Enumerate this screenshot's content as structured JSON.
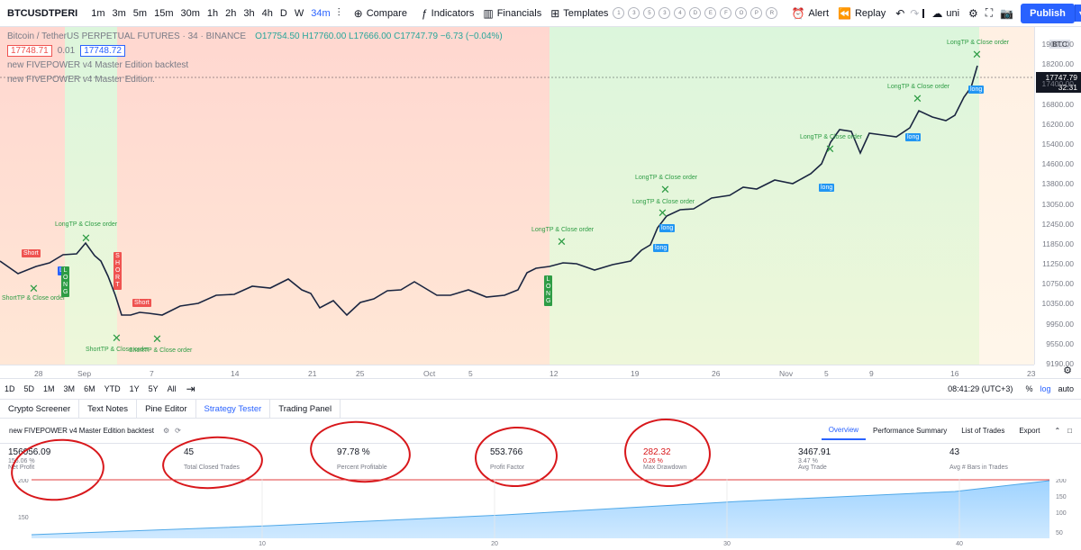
{
  "toolbar": {
    "symbol": "BTCUSDTPERI",
    "intervals": [
      "1m",
      "3m",
      "5m",
      "15m",
      "30m",
      "1h",
      "2h",
      "3h",
      "4h",
      "D",
      "W",
      "34m"
    ],
    "active_interval": "34m",
    "compare": "Compare",
    "indicators": "Indicators",
    "financials": "Financials",
    "templates": "Templates",
    "template_circles": [
      "1",
      "3",
      "5",
      "3",
      "4",
      "D",
      "E",
      "F",
      "O",
      "P",
      "R"
    ],
    "alert": "Alert",
    "replay": "Replay",
    "layout": "uni",
    "publish": "Publish"
  },
  "legend": {
    "title": "Bitcoin / TetherUS PERPETUAL FUTURES · 34 · BINANCE",
    "ohlc": "O17754.50  H17760.00  L17666.00  C17747.79  −6.73 (−0.04%)",
    "bid": "17748.71",
    "spread": "0.01",
    "ask": "17748.72",
    "study1": "new FIVEPOWER v4 Master Edition backtest",
    "study2": "new FIVEPOWER v4 Master Edition."
  },
  "price_axis": {
    "currency": "BTC",
    "current_price": "17747.79",
    "countdown": "32:31",
    "ticks": [
      "19000.00",
      "18200.00",
      "17400.00",
      "16800.00",
      "16200.00",
      "15400.00",
      "14600.00",
      "13800.00",
      "13050.00",
      "12450.00",
      "11850.00",
      "11250.00",
      "10750.00",
      "10350.00",
      "9950.00",
      "9550.00",
      "9190.00"
    ]
  },
  "time_axis": {
    "ticks": [
      "28",
      "Sep",
      "7",
      "14",
      "21",
      "25",
      "Oct",
      "5",
      "12",
      "19",
      "26",
      "Nov",
      "5",
      "9",
      "16",
      "23"
    ]
  },
  "signals": {
    "longtp": "LongTP & Close order",
    "shorttp": "ShortTP & Close order",
    "short": "Short",
    "long": "long",
    "vlong": "L O N G",
    "vshort": "S H O R T"
  },
  "bottom_bar": {
    "ranges": [
      "1D",
      "5D",
      "1M",
      "3M",
      "6M",
      "YTD",
      "1Y",
      "5Y",
      "All"
    ],
    "time": "08:41:29 (UTC+3)",
    "pct": "%",
    "log": "log",
    "auto": "auto"
  },
  "panel_tabs": [
    "Crypto Screener",
    "Text Notes",
    "Pine Editor",
    "Strategy Tester",
    "Trading Panel"
  ],
  "active_panel_tab": "Strategy Tester",
  "strategy": {
    "name": "new FIVEPOWER v4 Master Edition backtest",
    "tabs": [
      "Overview",
      "Performance Summary",
      "List of Trades",
      "Export"
    ],
    "active_tab": "Overview"
  },
  "metrics": [
    {
      "value": "156056.09",
      "sub": "156.06 %",
      "name": "Net Profit"
    },
    {
      "value": "45",
      "sub": "",
      "name": "Total Closed Trades"
    },
    {
      "value": "97.78 %",
      "sub": "",
      "name": "Percent Profitable"
    },
    {
      "value": "553.766",
      "sub": "",
      "name": "Profit Factor"
    },
    {
      "value": "282.32",
      "sub": "0.26 %",
      "name": "Max Drawdown"
    },
    {
      "value": "3467.91",
      "sub": "3.47 %",
      "name": "Avg Trade"
    },
    {
      "value": "43",
      "sub": "",
      "name": "Avg # Bars in Trades"
    }
  ],
  "equity_axis": {
    "left": [
      "200",
      "150"
    ],
    "right": [
      "200",
      "150",
      "100",
      "50"
    ],
    "x": [
      "10",
      "20",
      "30",
      "40"
    ]
  },
  "colors": {
    "accent": "#2962ff",
    "long": "#2e9c45",
    "short": "#ef5350",
    "loss": "#d8171b"
  }
}
